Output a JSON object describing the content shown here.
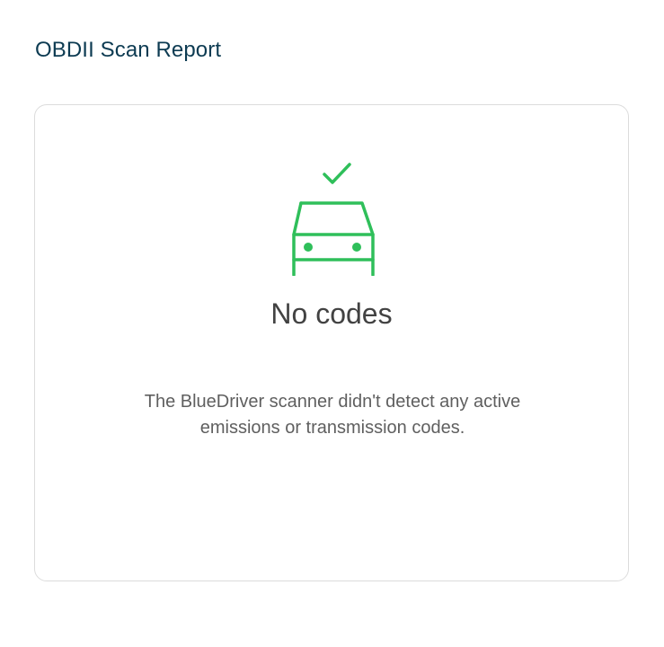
{
  "header": {
    "title": "OBDII Scan Report"
  },
  "result_card": {
    "icon": "car-check-icon",
    "heading": "No codes",
    "message": "The BlueDriver scanner didn't detect any active emissions or transmission codes."
  },
  "colors": {
    "accent_green": "#2fbf5a",
    "title_text": "#0d3b52",
    "heading_text": "#424242",
    "body_text": "#5f5f5f",
    "card_border": "#dcdcdc"
  }
}
